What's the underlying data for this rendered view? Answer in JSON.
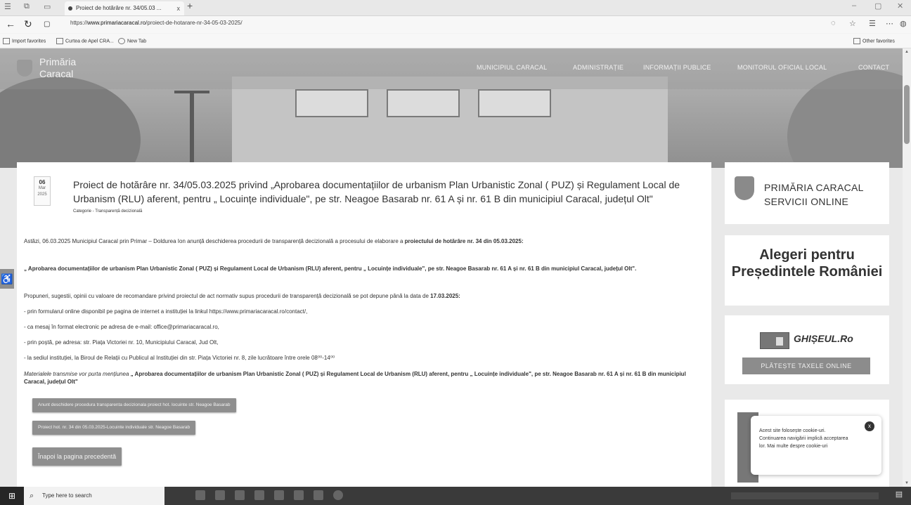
{
  "browser": {
    "tab_title": "Proiect de hotărâre nr. 34/05.03 ...",
    "tab_close": "x",
    "new_tab": "+",
    "url_prefix": "https://",
    "url_host": "www.primariacaracal.ro",
    "url_path": "/proiect-de-hotarare-nr-34-05-03-2025/",
    "favorites": [
      "Import favorites",
      "Curtea de Apel CRA...",
      "New Tab"
    ],
    "other_favorites": "Other favorites"
  },
  "site": {
    "logo_line1": "Primăria",
    "logo_line2": "Caracal",
    "menu": [
      "MUNICIPIUL CARACAL",
      "ADMINISTRAȚIE",
      "INFORMAȚII PUBLICE",
      "MONITORUL OFICIAL LOCAL",
      "CONTACT"
    ]
  },
  "article": {
    "date_day": "06",
    "date_month": "Mar",
    "date_year": "2025",
    "title": "Proiect de hotărâre nr. 34/05.03.2025 privind „Aprobarea documentațiilor de urbanism Plan Urbanistic Zonal ( PUZ) și Regulament Local de Urbanism (RLU) aferent, pentru „ Locuințe individuale\", pe str. Neagoe Basarab nr. 61 A și nr. 61 B din municipiul Caracal, județul Olt\"",
    "category": "Categorie - Transparență decizională",
    "p1_text": "Astăzi, 06.03.2025 Municipiul Caracal prin Primar – Doldurea Ion anunță deschiderea procedurii de transparență decizională a procesului de elaborare a ",
    "p1_bold": "proiectului de hotărâre nr. 34 din 05.03.2025:",
    "p2_bold": "„ Aprobarea documentațiilor de urbanism Plan Urbanistic Zonal ( PUZ) și Regulament Local de Urbanism (RLU) aferent, pentru „ Locuințe individuale\", pe str. Neagoe Basarab nr. 61 A și nr. 61 B din municipiul Caracal, județul Olt\".",
    "p3_text": "Propuneri, sugestii, opinii cu valoare de recomandare privind proiectul de act normativ supus procedurii de transparență decizională se pot depune până la data de ",
    "p3_bold": "17.03.2025:",
    "list": [
      "- prin formularul online disponibil pe pagina de internet a instituției la linkul https://www.primariacaracal.ro/contact/,",
      "- ca mesaj în format electronic pe adresa de e-mail: office@primariacaracal.ro,",
      "- prin poștă, pe adresa: str. Piața Victoriei nr. 10, Municipiului Caracal, Jud Olt,",
      "- la sediul instituției, la Biroul de Relații cu Publicul al Instituției din str. Piața Victoriei nr. 8, zile lucrătoare între orele 08⁰⁰-14⁰⁰"
    ],
    "p4_italic": "Materialele transmise vor purta mențiunea ",
    "p4_bold": "„ Aprobarea documentațiilor de urbanism Plan Urbanistic Zonal ( PUZ) și Regulament Local de Urbanism (RLU) aferent, pentru „ Locuințe individuale\", pe str. Neagoe Basarab nr. 61 A și nr. 61 B din municipiul Caracal, județul Olt\"",
    "button1": "Anunt deschidere procedura transparenta decizionala proiect hot. locuinte str. Neagoe Basarab",
    "button2": "Proiect hot. nr. 34 din 05.03.2025-Locuinte individuale str. Neagoe Basarab",
    "back_button": "Înapoi la pagina precedentă"
  },
  "sidebar": {
    "primaria_line1": "PRIMĂRIA CARACAL",
    "primaria_line2": "SERVICII ONLINE",
    "alegeri": "Alegeri pentru Președintele României",
    "ghiseul": "GHIȘEUL.Ro",
    "plateste": "PLĂTEȘTE TAXELE ONLINE"
  },
  "cookie": {
    "text": "Acest site folosește cookie-uri. Continuarea navigării implică acceptarea lor. Mai multe despre cookie-uri",
    "close": "x"
  },
  "taskbar": {
    "search_placeholder": "Type here to search"
  }
}
